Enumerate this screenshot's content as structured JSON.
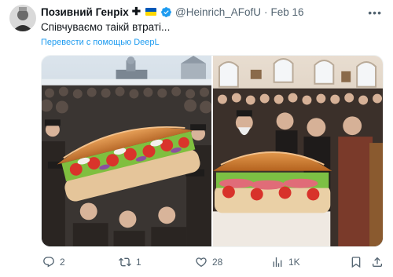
{
  "author": {
    "display_name": "Позивний Генріх",
    "cross_glyph": "✚",
    "handle": "@Heinrich_AFofU",
    "separator": "·",
    "date": "Feb 16"
  },
  "tweet": {
    "text": "Співчуваємо таікй втраті...",
    "translate_label": "Перевести с помощью DeepL"
  },
  "media": {
    "count": 2
  },
  "metrics": {
    "replies": "2",
    "reposts": "1",
    "likes": "28",
    "views": "1K"
  },
  "colors": {
    "accent": "#1d9bf0",
    "secondary_text": "#536471",
    "flag_blue": "#0057b7",
    "flag_yellow": "#ffd700"
  },
  "icons": [
    "more-icon",
    "verified-icon",
    "reply-icon",
    "retweet-icon",
    "like-icon",
    "views-icon",
    "bookmark-icon",
    "share-icon"
  ]
}
